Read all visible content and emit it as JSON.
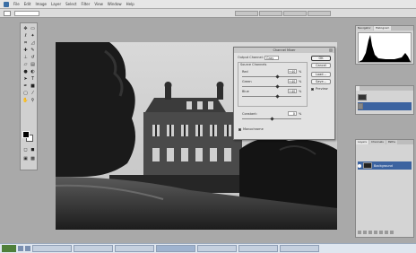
{
  "menu": {
    "items": [
      "File",
      "Edit",
      "Image",
      "Layer",
      "Select",
      "Filter",
      "View",
      "Window",
      "Help"
    ]
  },
  "options": {
    "preset": "",
    "workspace_tabs": [
      "",
      "",
      "",
      ""
    ]
  },
  "document": {
    "title": "",
    "photo": "castle-grayscale-photo"
  },
  "channel_mixer": {
    "title": "Channel Mixer",
    "output_channel_label": "Output Channel:",
    "output_channel_value": "Gray",
    "source_channels_label": "Source Channels",
    "sources": [
      {
        "label": "Red",
        "value": "+40",
        "unit": "%",
        "level": 0.6
      },
      {
        "label": "Green",
        "value": "+40",
        "unit": "%",
        "level": 0.6
      },
      {
        "label": "Blue",
        "value": "+40",
        "unit": "%",
        "level": 0.6
      }
    ],
    "constant_label": "Constant:",
    "constant_value": "0",
    "constant_level": 0.5,
    "monochrome_label": "Monochrome",
    "monochrome_checked": true,
    "buttons": {
      "ok": "OK",
      "cancel": "Cancel",
      "load": "Load...",
      "save": "Save..."
    },
    "preview_label": "Preview",
    "preview_checked": true
  },
  "histogram_panel": {
    "tabs": [
      "Navigator",
      "Histogram"
    ]
  },
  "mini_panel": {
    "items": [
      "",
      ""
    ]
  },
  "layers_panel": {
    "tabs": [
      "Layers",
      "Channels",
      "Paths"
    ],
    "layer_name": "Background"
  },
  "taskbar": {
    "tasks": [
      "",
      "",
      "",
      "",
      "",
      "",
      "",
      ""
    ],
    "clock": ""
  },
  "colors": {
    "accent": "#3c63a0",
    "foreground_swatch": "#000000",
    "background_swatch": "#ffffff"
  }
}
